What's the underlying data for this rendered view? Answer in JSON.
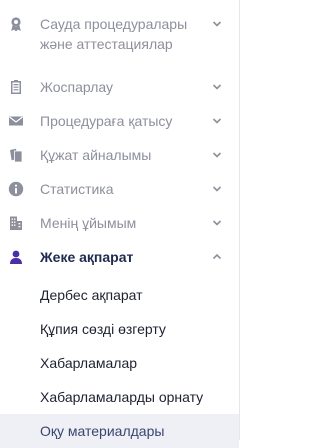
{
  "colors": {
    "icon_gray": "#8d909c",
    "text_gray": "#8d909c",
    "active_text": "#1e2a4f",
    "active_icon": "#4b2fa6",
    "sub_text": "#1e2130",
    "selected_bg": "#eef0f5"
  },
  "menu": {
    "trade": {
      "line1": "Сауда процедуралары",
      "line2": "және аттестациялар",
      "icon": "award-icon"
    },
    "planning": {
      "label": "Жоспарлау",
      "icon": "clipboard-icon"
    },
    "procedure": {
      "label": "Процедураға қатысу",
      "icon": "envelope-icon"
    },
    "docflow": {
      "label": "Құжат айналымы",
      "icon": "documents-icon"
    },
    "statistics": {
      "label": "Статистика",
      "icon": "info-icon"
    },
    "organization": {
      "label": "Менің ұйымым",
      "icon": "building-icon"
    },
    "personal": {
      "label": "Жеке ақпарат",
      "icon": "user-icon",
      "expanded": true,
      "sub": [
        "Дербес ақпарат",
        "Құпия сөзді өзгерту",
        "Хабарламалар",
        "Хабарламаларды орнату",
        "Оқу материалдары"
      ]
    }
  }
}
